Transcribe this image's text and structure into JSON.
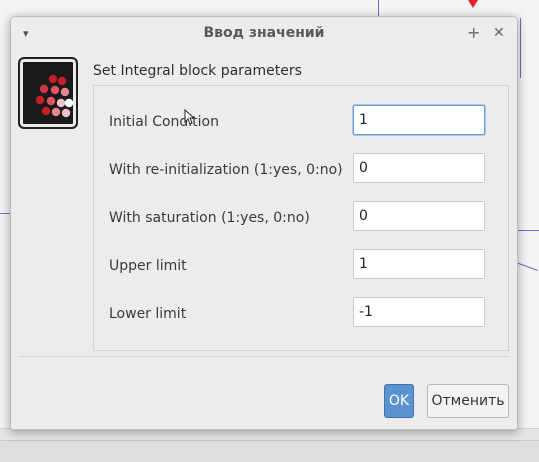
{
  "dialog": {
    "title": "Ввод значений",
    "menu_glyph": "▾",
    "maximize_glyph": "+",
    "close_glyph": "✕",
    "header": "Set Integral block parameters",
    "icon_name": "integral-block-icon"
  },
  "params": [
    {
      "label": "Initial Condition",
      "value": "1"
    },
    {
      "label": "With re-initialization (1:yes, 0:no)",
      "value": "0"
    },
    {
      "label": "With saturation (1:yes, 0:no)",
      "value": "0"
    },
    {
      "label": "Upper limit",
      "value": "1"
    },
    {
      "label": "Lower limit",
      "value": "-1"
    }
  ],
  "buttons": {
    "ok": "OK",
    "cancel": "Отменить"
  },
  "colors": {
    "ok_button": "#5b93d0",
    "diagram_lines": "#6b6bd6",
    "diagram_red": "#e0262b"
  }
}
